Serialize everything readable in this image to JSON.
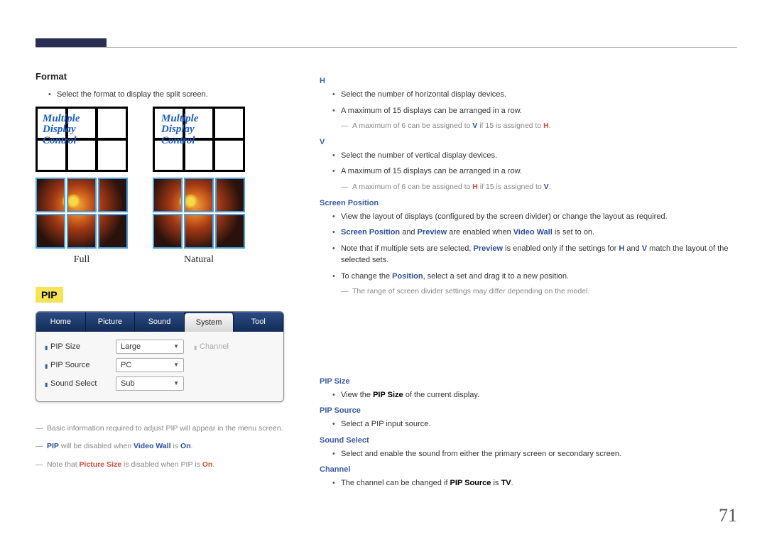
{
  "left": {
    "format": {
      "heading": "Format",
      "desc": "Select the format to display the split screen.",
      "grid_text": "Multiple\nDisplay\nControl",
      "full": "Full",
      "natural": "Natural"
    },
    "pip": {
      "badge": "PIP",
      "tabs": [
        "Home",
        "Picture",
        "Sound",
        "System",
        "Tool"
      ],
      "active_tab_index": 3,
      "rows": [
        {
          "label": "PIP Size",
          "value": "Large",
          "extra_label": "Channel"
        },
        {
          "label": "PIP Source",
          "value": "PC"
        },
        {
          "label": "Sound Select",
          "value": "Sub"
        }
      ]
    },
    "notes": {
      "n1": "Basic information required to adjust PIP will appear in the menu screen.",
      "n2_parts": {
        "a": "PIP",
        "b": " will be disabled when ",
        "c": "Video Wall",
        "d": " is ",
        "e": "On",
        "f": "."
      },
      "n3_parts": {
        "a": "Note that ",
        "b": "Picture Size",
        "c": " is disabled when PIP is ",
        "d": "On",
        "e": "."
      }
    }
  },
  "right": {
    "h": {
      "heading": "H",
      "b1": "Select the number of horizontal display devices.",
      "b2": "A maximum of 15 displays can be arranged in a row.",
      "note_parts": {
        "a": "A maximum of 6 can be assigned to ",
        "b": "V",
        "c": " if 15 is assigned to ",
        "d": "H",
        "e": "."
      }
    },
    "v": {
      "heading": "V",
      "b1": "Select the number of vertical display devices.",
      "b2": "A maximum of 15 displays can be arranged in a row.",
      "note_parts": {
        "a": "A maximum of 6 can be assigned to ",
        "b": "H",
        "c": " if 15 is assigned to ",
        "d": "V",
        "e": "."
      }
    },
    "sp": {
      "heading": "Screen Position",
      "b1": "View the layout of displays (configured by the screen divider) or change the layout as required.",
      "b2_parts": {
        "a": "Screen Position",
        "b": " and ",
        "c": "Preview",
        "d": " are enabled when ",
        "e": "Video Wall",
        "f": " is set to on."
      },
      "b3_parts": {
        "a": "Note that if multiple sets are selected, ",
        "b": "Preview",
        "c": " is enabled only if the settings for ",
        "d": "H",
        "e": " and ",
        "f": "V",
        "g": " match the layout of the selected sets."
      },
      "b4_parts": {
        "a": "To change the ",
        "b": "Position",
        "c": ", select a set and drag it to a new position."
      },
      "note": "The range of screen divider settings may differ depending on the model."
    },
    "pip_size": {
      "heading": "PIP Size",
      "b1_parts": {
        "a": "View the ",
        "b": "PIP Size",
        "c": " of the current display."
      }
    },
    "pip_source": {
      "heading": "PIP Source",
      "b1": "Select a PIP input source."
    },
    "sound_select": {
      "heading": "Sound Select",
      "b1": "Select and enable the sound from either the primary screen or secondary screen."
    },
    "channel": {
      "heading": "Channel",
      "b1_parts": {
        "a": "The channel can be changed if ",
        "b": "PIP Source",
        "c": " is ",
        "d": "TV",
        "e": "."
      }
    }
  },
  "page_number": "71"
}
